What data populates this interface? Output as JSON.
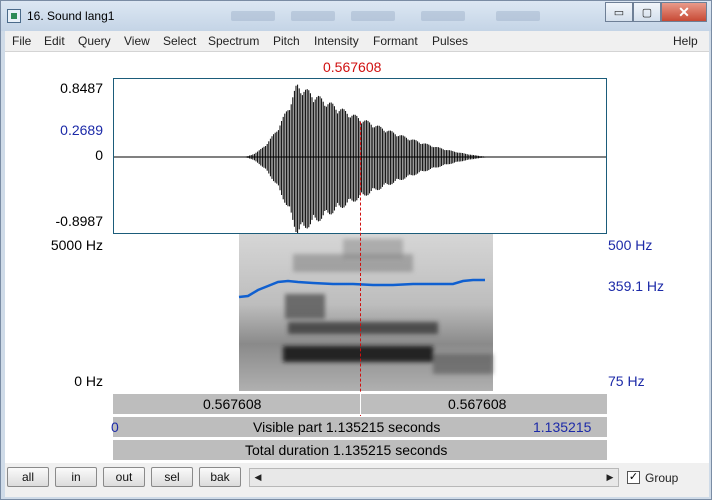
{
  "window": {
    "title": "16. Sound lang1",
    "minimize_label": "▭",
    "maximize_label": "▢",
    "close_label": "✕"
  },
  "menu": [
    "File",
    "Edit",
    "Query",
    "View",
    "Select",
    "Spectrum",
    "Pitch",
    "Intensity",
    "Formant",
    "Pulses",
    "Help"
  ],
  "cursor_time": "0.567608",
  "waveform": {
    "y_max": "0.8487",
    "y_cursor": "0.2689",
    "y_zero": "0",
    "y_min": "-0.8987",
    "cursor_fraction": 0.5
  },
  "spectrogram": {
    "freq_top": "5000 Hz",
    "freq_bottom": "0 Hz",
    "pitch_top": "500 Hz",
    "pitch_current": "359.1 Hz",
    "pitch_bottom": "75 Hz",
    "pitch_color": "#1060d0"
  },
  "selection_bar": {
    "left": "0.567608",
    "right": "0.567608"
  },
  "visible_bar": {
    "start": "0",
    "text": "Visible part 1.135215 seconds",
    "end": "1.135215"
  },
  "total_bar": {
    "text": "Total duration 1.135215 seconds"
  },
  "toolbar": {
    "buttons": [
      "all",
      "in",
      "out",
      "sel",
      "bak"
    ],
    "group_label": "Group",
    "group_checked": true
  },
  "colors": {
    "cursor": "#d01010",
    "axis_blue": "#1c2aa8"
  }
}
